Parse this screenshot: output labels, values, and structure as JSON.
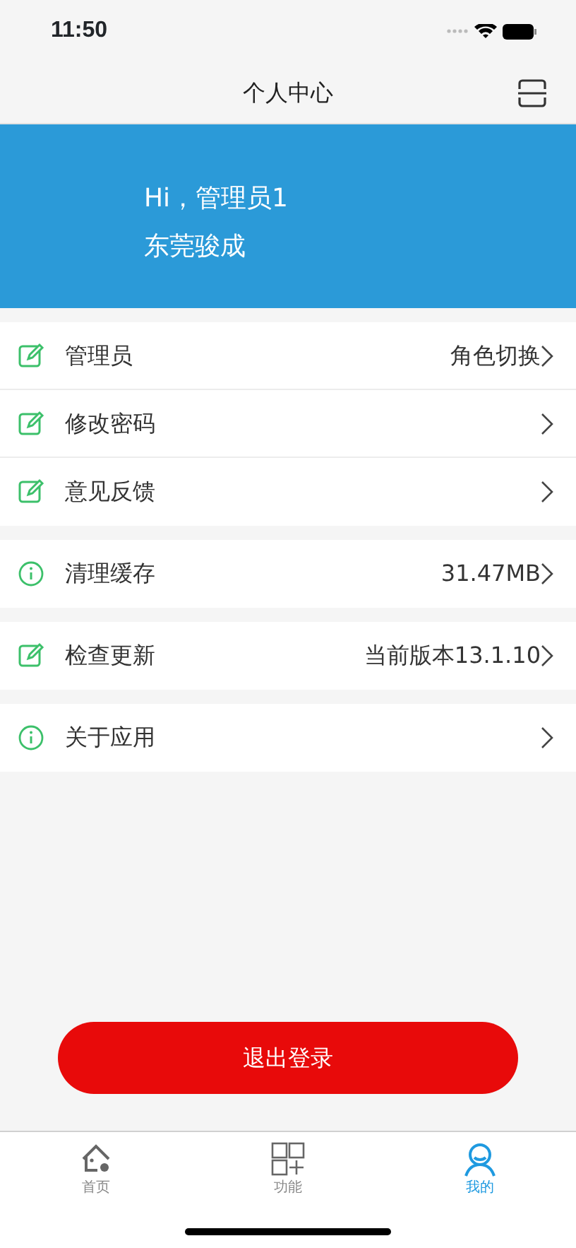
{
  "status_bar": {
    "time": "11:50"
  },
  "header": {
    "title": "个人中心"
  },
  "banner": {
    "greeting": "Hi，管理员1",
    "company": "东莞骏成"
  },
  "groups": [
    {
      "rows": [
        {
          "kind": "edit",
          "label": "管理员",
          "value": "角色切换"
        },
        {
          "kind": "edit",
          "label": "修改密码"
        },
        {
          "kind": "edit",
          "label": "意见反馈"
        }
      ]
    },
    {
      "rows": [
        {
          "kind": "info",
          "label": "清理缓存",
          "value": "31.47MB"
        }
      ]
    },
    {
      "rows": [
        {
          "kind": "edit",
          "label": "检查更新",
          "value": "当前版本13.1.10"
        }
      ]
    },
    {
      "rows": [
        {
          "kind": "info",
          "label": "关于应用"
        }
      ]
    }
  ],
  "logout_button": "退出登录",
  "tabs": [
    {
      "kind": "home",
      "label": "首页",
      "selected": false
    },
    {
      "kind": "grid",
      "label": "功能",
      "selected": false
    },
    {
      "kind": "person",
      "label": "我的",
      "selected": true
    }
  ]
}
